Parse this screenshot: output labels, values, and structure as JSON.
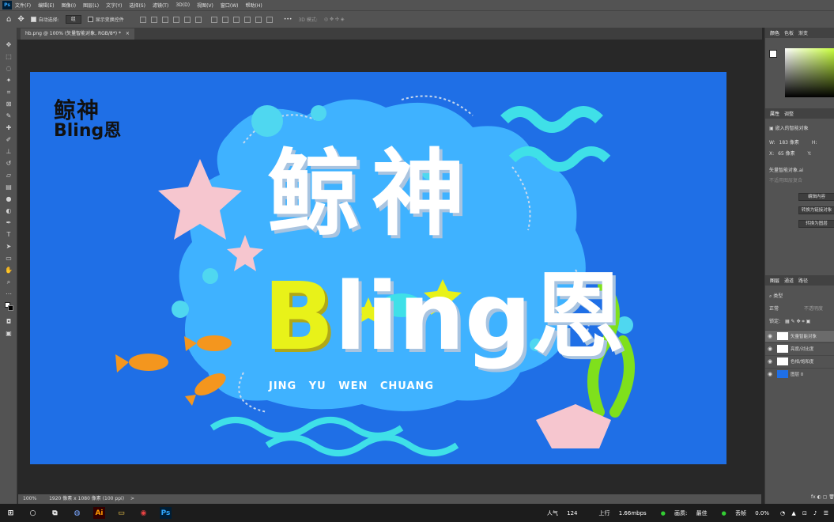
{
  "menubar": {
    "app_icon": "Ps",
    "items": [
      "文件(F)",
      "编辑(E)",
      "图像(I)",
      "图层(L)",
      "文字(Y)",
      "选择(S)",
      "滤镜(T)",
      "3D(D)",
      "视图(V)",
      "窗口(W)",
      "帮助(H)"
    ]
  },
  "options": {
    "auto_select_label": "自动选择:",
    "auto_select_value": "组",
    "show_transform_label": "显示变换控件",
    "mode_3d_label": "3D 模式:"
  },
  "document": {
    "tab_title": "hb.png @ 100% (矢量智能对象, RGB/8*) *",
    "tab_close": "×"
  },
  "artwork": {
    "logo_line1": "鲸神",
    "logo_line2": "Bling恩",
    "title_cn": "鲸神",
    "title_en_b": "B",
    "title_en_rest": "ling",
    "title_en_end": "恩",
    "subtitle": "JING YU WEN CHUANG",
    "colors": {
      "background": "#1f6fe6",
      "cloud": "#3fb2ff",
      "accent_yellow": "#e8f219",
      "accent_orange": "#f4961e",
      "accent_green": "#7fe01c",
      "pink": "#f6c6cf"
    }
  },
  "status": {
    "zoom": "100%",
    "doc_info": "1920 像素 x 1080 像素 (100 ppi)"
  },
  "panels": {
    "color_tabs": [
      "颜色",
      "色板",
      "渐变"
    ],
    "props_tabs": [
      "属性",
      "调整"
    ],
    "props_type": "嵌入的智能对象",
    "w_label": "W:",
    "w_value": "183 像素",
    "h_label": "H:",
    "x_label": "X:",
    "x_value": "65 像素",
    "y_label": "Y:",
    "smart_object_label": "矢量智能对象.ai",
    "unavailable": "不适用图层复合",
    "buttons": [
      "编辑内容",
      "转换为链接对象",
      "转换为图层"
    ],
    "layer_tabs": [
      "图层",
      "通道",
      "路径"
    ],
    "filter_kind": "类型",
    "blend_mode": "正常",
    "opacity_label": "不透明度",
    "lock_label": "锁定:",
    "layers": [
      {
        "name": "矢量智能对象",
        "active": true
      },
      {
        "name": "亮度/对比度",
        "active": false
      },
      {
        "name": "色相/饱和度",
        "active": false
      },
      {
        "name": "图层 0",
        "active": false
      }
    ]
  },
  "taskbar": {
    "apps": [
      "⊞",
      "○",
      "⧉",
      "◍",
      "Ai",
      "▭",
      "◉",
      "Ps"
    ],
    "network_label": "人气",
    "network_value": "124",
    "upload_label": "上行",
    "upload_value": "1.66mbps",
    "quality_label": "画质:",
    "quality_value": "最佳",
    "loss_label": "丢帧",
    "loss_value": "0.0%"
  }
}
